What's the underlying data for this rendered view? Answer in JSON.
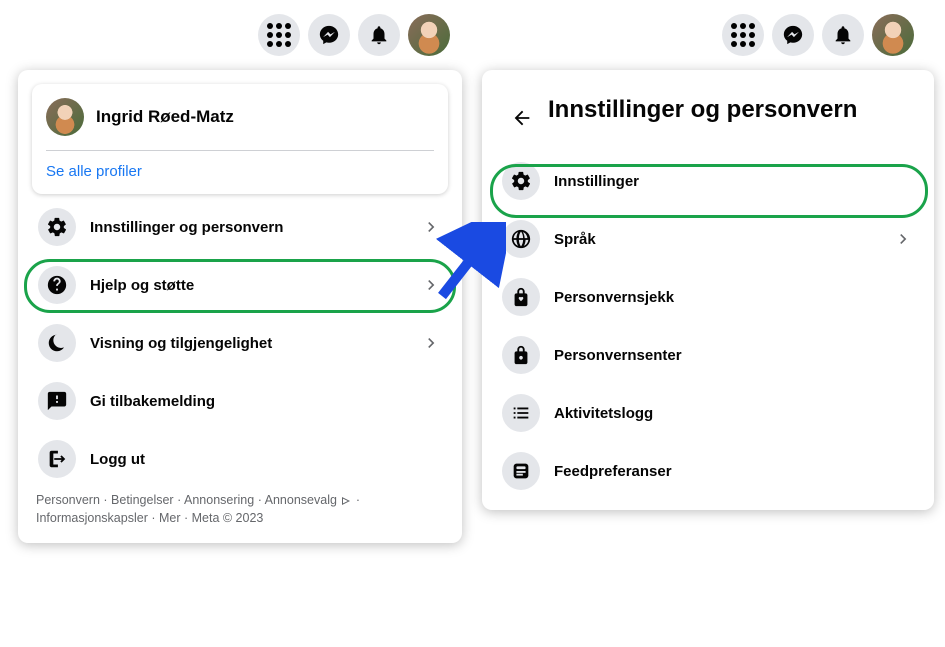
{
  "topbar": {
    "menu_icon": "grid-icon",
    "messenger_icon": "messenger-icon",
    "notifications_icon": "bell-icon",
    "avatar_icon": "avatar"
  },
  "left_panel": {
    "profile": {
      "name": "Ingrid Røed-Matz",
      "see_all_label": "Se alle profiler"
    },
    "menu": [
      {
        "key": "settings-privacy",
        "label": "Innstillinger og personvern",
        "icon": "gear-icon",
        "chevron": true
      },
      {
        "key": "help-support",
        "label": "Hjelp og støtte",
        "icon": "question-icon",
        "chevron": true
      },
      {
        "key": "display-accessibility",
        "label": "Visning og tilgjengelighet",
        "icon": "moon-icon",
        "chevron": true
      },
      {
        "key": "feedback",
        "label": "Gi tilbakemelding",
        "icon": "feedback-icon",
        "chevron": false
      },
      {
        "key": "logout",
        "label": "Logg ut",
        "icon": "logout-icon",
        "chevron": false
      }
    ],
    "footer": {
      "links": [
        "Personvern",
        "Betingelser",
        "Annonsering",
        "Annonsevalg"
      ],
      "links2": [
        "Informasjonskapsler",
        "Mer"
      ],
      "copyright": "Meta © 2023"
    }
  },
  "right_panel": {
    "title": "Innstillinger og personvern",
    "menu": [
      {
        "key": "settings",
        "label": "Innstillinger",
        "icon": "gear-icon",
        "chevron": false
      },
      {
        "key": "language",
        "label": "Språk",
        "icon": "globe-icon",
        "chevron": true
      },
      {
        "key": "privacy-check",
        "label": "Personvernsjekk",
        "icon": "lock-heart-icon",
        "chevron": false
      },
      {
        "key": "privacy-center",
        "label": "Personvernsenter",
        "icon": "lock-icon",
        "chevron": false
      },
      {
        "key": "activity-log",
        "label": "Aktivitetslogg",
        "icon": "list-icon",
        "chevron": false
      },
      {
        "key": "feed-preferences",
        "label": "Feedpreferanser",
        "icon": "feed-icon",
        "chevron": false
      }
    ]
  },
  "annotation": {
    "highlight_color": "#1aa34a",
    "arrow_color": "#1a4ae2"
  }
}
